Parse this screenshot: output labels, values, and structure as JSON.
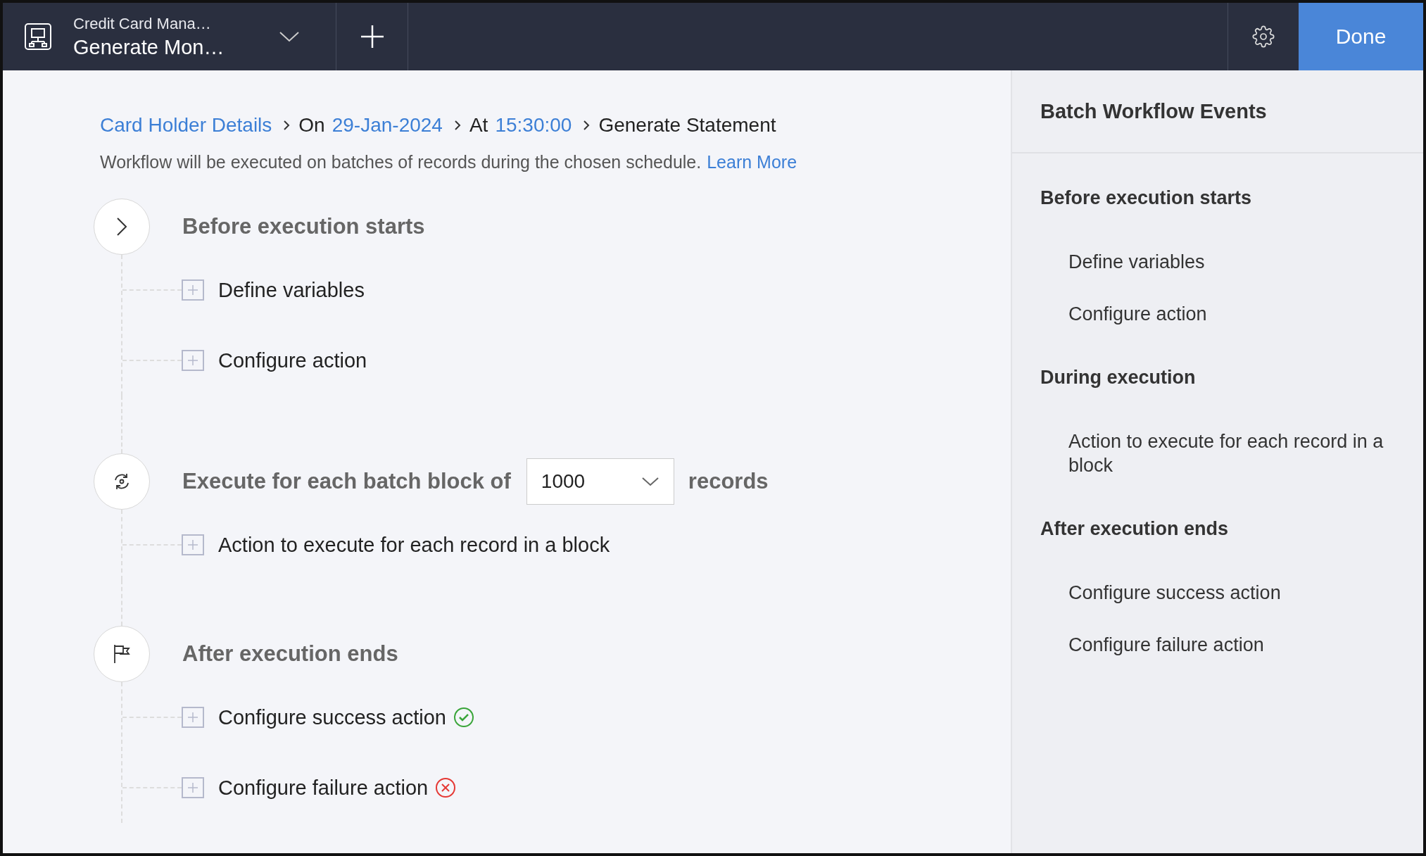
{
  "header": {
    "subtitle": "Credit Card Mana…",
    "title": "Generate Mon…",
    "done": "Done"
  },
  "breadcrumb": [
    {
      "link": "Card Holder Details"
    },
    {
      "label": "On",
      "link": "29-Jan-2024"
    },
    {
      "label": "At",
      "link": "15:30:00"
    },
    {
      "label": "Generate Statement"
    }
  ],
  "description": {
    "text": "Workflow will be executed on batches of records during the chosen schedule.",
    "link": "Learn More"
  },
  "stages": [
    {
      "kind": "start",
      "title": "Before execution starts",
      "children": [
        {
          "label": "Define variables"
        },
        {
          "label": "Configure action"
        }
      ]
    },
    {
      "kind": "batch",
      "title": "Execute for each batch block of",
      "select": "1000",
      "suffix": "records",
      "children": [
        {
          "label": "Action to execute for each record in a block"
        }
      ]
    },
    {
      "kind": "end",
      "title": "After execution ends",
      "children": [
        {
          "label": "Configure success action",
          "kind": "success"
        },
        {
          "label": "Configure failure action",
          "kind": "failure"
        }
      ]
    }
  ],
  "panel": {
    "title": "Batch Workflow Events",
    "sections": [
      {
        "title": "Before execution starts",
        "items": [
          "Define variables",
          "Configure action"
        ]
      },
      {
        "title": "During execution",
        "items": [
          "Action to execute for each record in a block"
        ]
      },
      {
        "title": "After execution ends",
        "items": [
          "Configure success action",
          "Configure failure action"
        ]
      }
    ]
  }
}
